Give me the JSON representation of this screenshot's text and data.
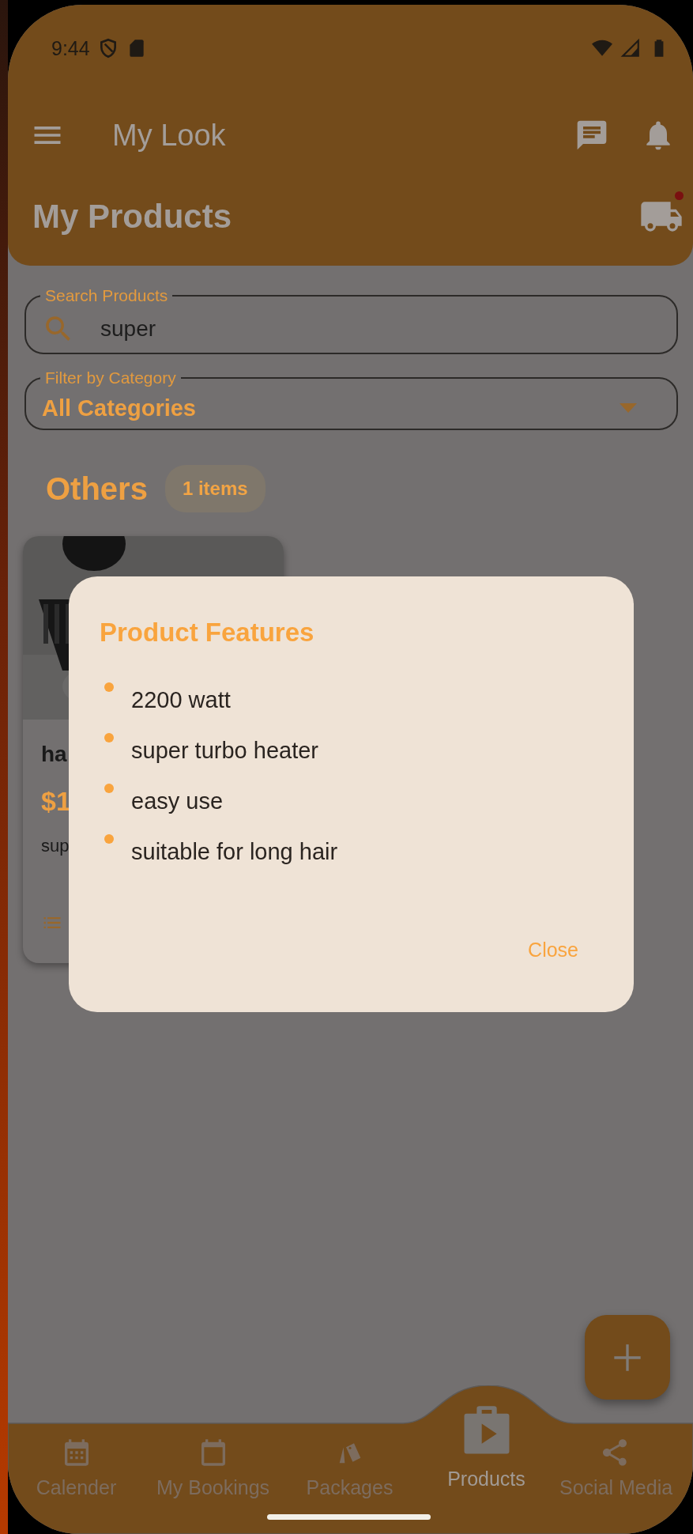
{
  "status_bar": {
    "time": "9:44"
  },
  "app_bar": {
    "title": "My Look"
  },
  "page": {
    "title": "My Products",
    "delivery_notification": true
  },
  "search": {
    "label": "Search Products",
    "value": "super"
  },
  "filter": {
    "label": "Filter by Category",
    "value": "All Categories"
  },
  "section": {
    "title": "Others",
    "count": "1 items"
  },
  "product_card": {
    "name": "ha",
    "price": "$1",
    "description": "sup"
  },
  "dialog": {
    "title": "Product Features",
    "features": [
      "2200 watt",
      "super turbo heater",
      "easy use",
      "suitable for long hair"
    ],
    "button": "Close"
  },
  "nav": [
    {
      "label": "Calender",
      "kind": "calendar",
      "selected": false
    },
    {
      "label": "My Bookings",
      "kind": "bookings",
      "selected": false
    },
    {
      "label": "Packages",
      "kind": "packages",
      "selected": false
    },
    {
      "label": "Products",
      "kind": "products",
      "selected": true
    },
    {
      "label": "Social Media",
      "kind": "share",
      "selected": false
    }
  ]
}
